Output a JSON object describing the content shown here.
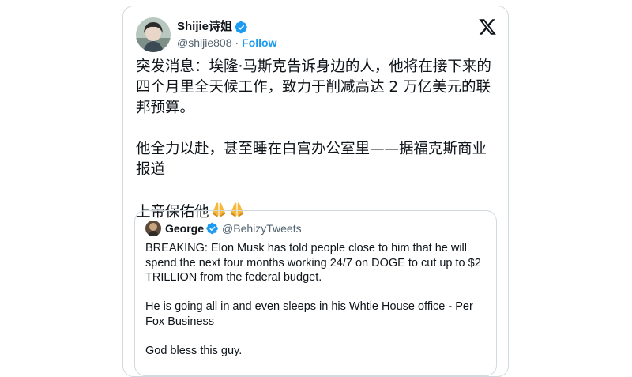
{
  "tweet": {
    "author_name": "Shijie诗姐",
    "author_handle": "@shijie808",
    "separator": "·",
    "follow_label": "Follow",
    "paragraphs": [
      "突发消息：埃隆·马斯克告诉身边的人，他将在接下来的四个月里全天候工作，致力于削减高达 2 万亿美元的联邦预算。",
      "他全力以赴，甚至睡在白宫办公室里——据福克斯商业报道",
      "上帝保佑他"
    ],
    "emoji": [
      "folded-hands",
      "folded-hands"
    ]
  },
  "quote": {
    "author_name": "George",
    "author_handle": "@BehizyTweets",
    "paragraphs": [
      "BREAKING: Elon Musk has told people close to him that he will spend the next four months working 24/7 on DOGE to cut up to $2 TRILLION from the federal budget.",
      "He is going all in and even sleeps in his Whtie House office - Per Fox Business",
      "God bless this guy."
    ]
  },
  "icons": {
    "verified": "verified-badge-icon",
    "platform": "x-logo-icon"
  },
  "colors": {
    "accent": "#1d9bf0",
    "text": "#0f1419",
    "secondary": "#536471",
    "border": "#cfd9de"
  }
}
